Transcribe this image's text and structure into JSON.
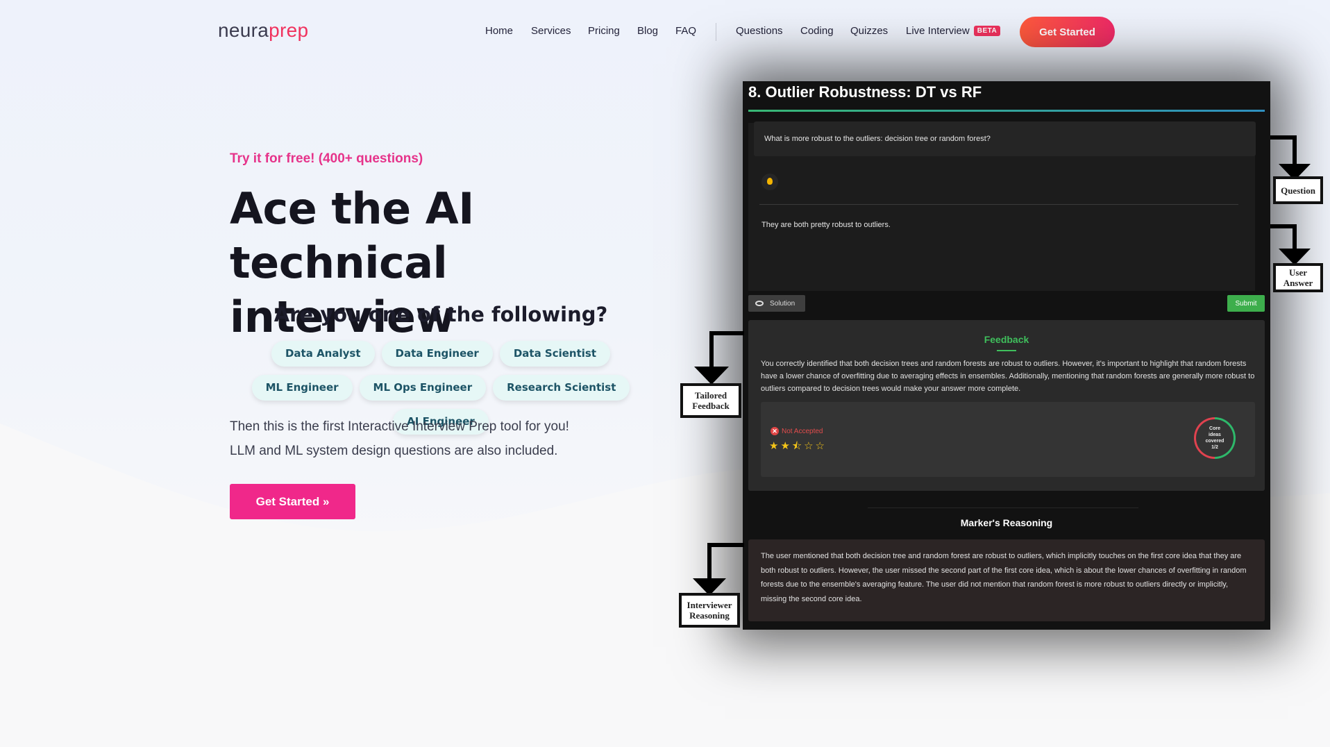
{
  "brand": {
    "logo_part1": "neura",
    "logo_part2": "prep"
  },
  "nav": {
    "links": [
      "Home",
      "Services",
      "Pricing",
      "Blog",
      "FAQ"
    ],
    "tools": [
      "Questions",
      "Coding",
      "Quizzes",
      "Live Interview"
    ],
    "beta_badge": "BETA",
    "cta": "Get Started"
  },
  "hero": {
    "tagline": "Try it for free! (400+ questions)",
    "headline_line1": "Ace the AI technical",
    "headline_line2": "interview",
    "subheading": "Are you one of the following?",
    "roles": [
      "Data Analyst",
      "Data Engineer",
      "Data Scientist",
      "ML Engineer",
      "ML Ops Engineer",
      "Research Scientist",
      "AI Engineer"
    ],
    "paragraph1": "Then this is the first Interactive Interview Prep tool for you!",
    "paragraph2": "LLM and ML system design questions are also included.",
    "cta": "Get Started »"
  },
  "demo": {
    "title": "8. Outlier Robustness: DT vs RF",
    "question": "What is more robust to the outliers: decision tree or random forest?",
    "user_answer": "They are both pretty robust to outliers.",
    "solution_button": "Solution",
    "submit_button": "Submit",
    "feedback_title": "Feedback",
    "feedback_text": "You correctly identified that both decision trees and random forests are robust to outliers. However, it's important to highlight that random forests have a lower chance of overfitting due to averaging effects in ensembles. Additionally, mentioning that random forests are generally more robust to outliers compared to decision trees would make your answer more complete.",
    "status": "Not Accepted",
    "rating": 2.5,
    "rating_max": 5,
    "stars_text": "★★⯪☆☆",
    "core_ideas_label": "Core ideas covered",
    "core_ideas_value": "1/2",
    "core_ideas_fraction": 0.5,
    "reasoning_title": "Marker's Reasoning",
    "reasoning_text": "The user mentioned that both decision tree and random forest are robust to outliers, which implicitly touches on the first core idea that they are both robust to outliers. However, the user missed the second part of the first core idea, which is about the lower chances of overfitting in random forests due to the ensemble's averaging feature. The user did not mention that random forest is more robust to outliers directly or implicitly, missing the second core idea."
  },
  "annotations": {
    "question": "Question",
    "user_answer_1": "User",
    "user_answer_2": "Answer",
    "feedback_1": "Tailored",
    "feedback_2": "Feedback",
    "reasoning_1": "Interviewer",
    "reasoning_2": "Reasoning"
  },
  "colors": {
    "accent": "#f0325e",
    "cta_gradient_start": "#ff5a3c",
    "hero_button": "#f0288a",
    "tagline": "#e6338a",
    "chip_bg": "#e6f7f6",
    "success": "#3fbf5c"
  }
}
